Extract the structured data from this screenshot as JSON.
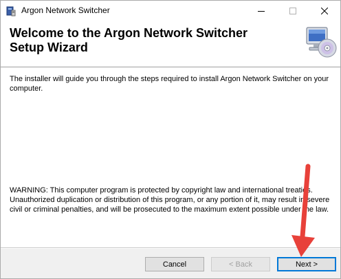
{
  "window": {
    "title": "Argon Network Switcher"
  },
  "header": {
    "title": "Welcome to the Argon Network Switcher Setup Wizard"
  },
  "content": {
    "intro": "The installer will guide you through the steps required to install Argon Network Switcher on your computer.",
    "warning": "WARNING: This computer program is protected by copyright law and international treaties. Unauthorized duplication or distribution of this program, or any portion of it, may result in severe civil or criminal penalties, and will be prosecuted to the maximum extent possible under the law."
  },
  "buttons": {
    "cancel": "Cancel",
    "back": "< Back",
    "next": "Next >"
  },
  "icons": {
    "app": "installer-icon",
    "header": "computer-cd-icon",
    "annotation": "red-arrow-icon"
  },
  "colors": {
    "accent": "#0078d7",
    "arrow": "#e8413a"
  }
}
